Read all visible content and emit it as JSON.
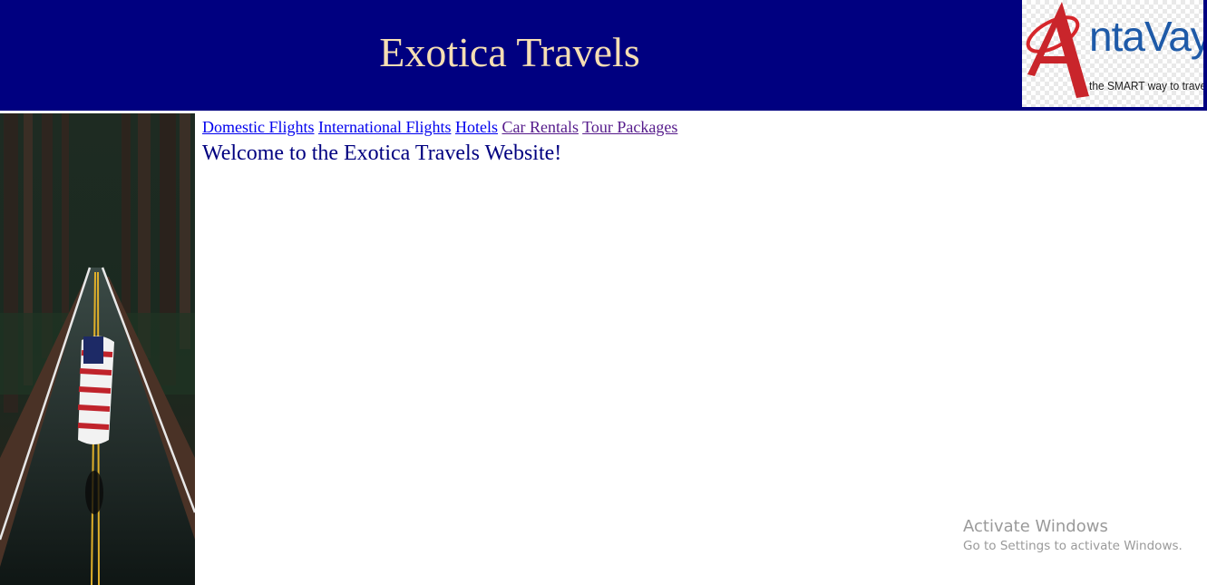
{
  "header": {
    "title": "Exotica Travels",
    "background_color": "#000080",
    "title_color": "#f5deb3"
  },
  "logo": {
    "brand_letter": "A",
    "brand_text": "ntaVaya",
    "tagline": "the SMART way to travel"
  },
  "nav": {
    "links": [
      {
        "label": "Domestic Flights",
        "state": "unvisited"
      },
      {
        "label": "International Flights",
        "state": "unvisited"
      },
      {
        "label": "Hotels",
        "state": "unvisited"
      },
      {
        "label": "Car Rentals",
        "state": "visited"
      },
      {
        "label": "Tour Packages",
        "state": "visited"
      }
    ],
    "link_color": "#0000ee",
    "visited_color": "#551a8b"
  },
  "main": {
    "welcome": "Welcome to the Exotica Travels Website!"
  },
  "side_image": {
    "icon": "forest-road-flag-photo"
  },
  "watermark": {
    "title": "Activate Windows",
    "subtitle": "Go to Settings to activate Windows."
  }
}
